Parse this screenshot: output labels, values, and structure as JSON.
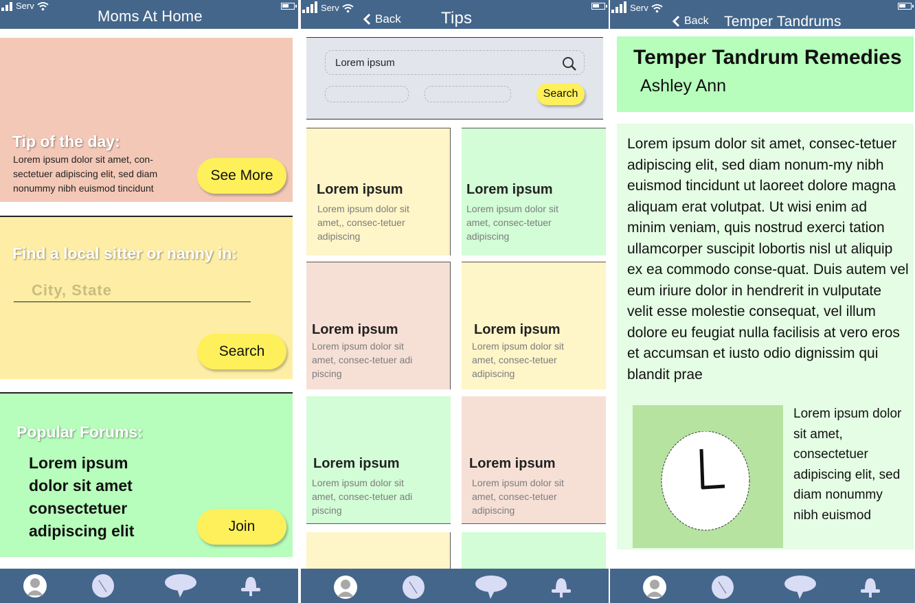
{
  "status_bar": {
    "carrier": "Serv"
  },
  "nav_icons": [
    "profile-icon",
    "feather-icon",
    "chat-bubble-icon",
    "notification-bell-icon"
  ],
  "colors": {
    "bar": "#44668a",
    "tip_card": "#f4c8b7",
    "find_card": "#feeda4",
    "forums_card": "#b7fdbb",
    "button_yellow": "#fdf05a"
  },
  "screen_home": {
    "title": "Moms At Home",
    "tip": {
      "heading": "Tip of the day:",
      "text": "Lorem ipsum dolor sit amet, con-sectetuer adipiscing elit, sed diam nonummy nibh euismod tincidunt",
      "button": "See More"
    },
    "find": {
      "heading": "Find a local sitter or nanny in:",
      "placeholder": "City, State",
      "button": "Search"
    },
    "forums": {
      "heading": "Popular Forums:",
      "items": [
        "Lorem ipsum",
        "dolor sit amet",
        "consectetuer",
        "adipiscing elit"
      ],
      "button": "Join"
    }
  },
  "screen_tips": {
    "back": "Back",
    "title": "Tips",
    "search": {
      "value": "Lorem ipsum",
      "button": "Search"
    },
    "tiles": [
      {
        "title": "Lorem ipsum",
        "body": "Lorem ipsum dolor sit amet,, consec-tetuer adipiscing",
        "color": "#fef5c8"
      },
      {
        "title": "Lorem ipsum",
        "body": "Lorem ipsum dolor sit amet, consec-tetuer adipiscing",
        "color": "#d2fdd6"
      },
      {
        "title": "Lorem ipsum",
        "body": "Lorem ipsum dolor sit amet, consec-tetuer adi piscing",
        "color": "#f6e0d6"
      },
      {
        "title": "Lorem ipsum",
        "body": "Lorem ipsum dolor sit amet, consec-tetuer adipiscing",
        "color": "#fef5c8"
      },
      {
        "title": "Lorem ipsum",
        "body": "Lorem ipsum dolor sit amet, consec-tetuer adi piscing",
        "color": "#d2fdd6"
      },
      {
        "title": "Lorem ipsum",
        "body": "Lorem ipsum dolor sit amet, consec-tetuer adipiscing",
        "color": "#f6e0d6"
      }
    ]
  },
  "screen_article": {
    "back": "Back",
    "title": "Temper Tandrums",
    "heading": "Temper Tandrum Remedies",
    "author": "Ashley Ann",
    "body": "Lorem ipsum dolor sit amet, consec-tetuer adipiscing elit, sed diam nonum-my nibh euismod tincidunt ut laoreet dolore magna aliquam erat volutpat. Ut wisi enim ad minim veniam, quis nostrud exerci tation ullamcorper suscipit lobortis nisl ut aliquip ex ea commodo conse-quat. Duis autem vel eum iriure dolor in hendrerit in vulputate velit esse molestie consequat, vel illum dolore eu feugiat nulla facilisis at vero eros et accumsan et iusto odio dignissim qui blandit prae",
    "side_text": "Lorem ipsum dolor sit amet, consectetuer adipiscing elit, sed diam nonummy nibh euismod"
  }
}
